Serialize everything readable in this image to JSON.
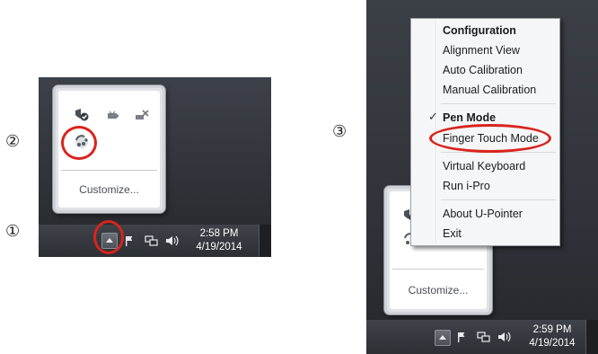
{
  "steps": {
    "one": "①",
    "two": "②",
    "three": "③"
  },
  "left_panel": {
    "flyout": {
      "customize_label": "Customize...",
      "icons": [
        "shield-icon",
        "battery-icon",
        "disconnected-network-icon",
        "u-pointer-icon"
      ]
    },
    "taskbar": {
      "show_hidden_icons": "show-hidden-icons-button",
      "clock_time": "2:58 PM",
      "clock_date": "4/19/2014"
    }
  },
  "right_panel": {
    "flyout": {
      "customize_label": "Customize..."
    },
    "taskbar": {
      "clock_time": "2:59 PM",
      "clock_date": "4/19/2014"
    },
    "context_menu": {
      "items": [
        {
          "label": "Configuration",
          "bold": true
        },
        {
          "label": "Alignment View"
        },
        {
          "label": "Auto Calibration"
        },
        {
          "label": "Manual Calibration"
        },
        {
          "label": "Pen Mode",
          "bold": true,
          "checked": true
        },
        {
          "label": "Finger Touch Mode",
          "highlighted": true
        },
        {
          "label": "Virtual Keyboard"
        },
        {
          "label": "Run i-Pro"
        },
        {
          "label": "About U-Pointer"
        },
        {
          "label": "Exit"
        }
      ],
      "check_glyph": "✓"
    }
  },
  "colors": {
    "highlight_ring": "#d9231d",
    "taskbar_bg": "#2c2f34",
    "menu_bg": "#f5f6f7"
  }
}
